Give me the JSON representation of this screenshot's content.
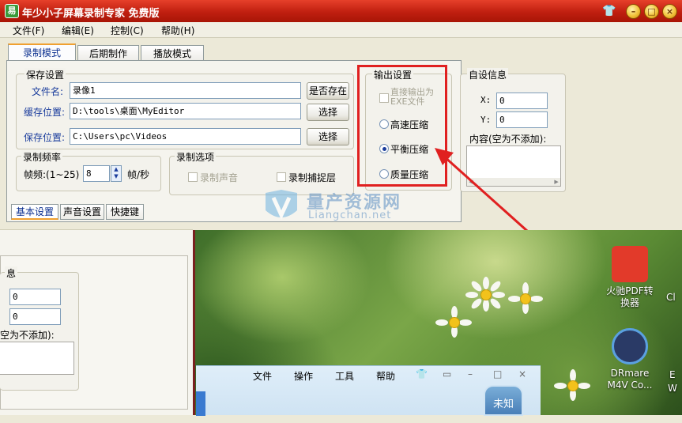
{
  "window": {
    "title": "年少小子屏幕录制专家 免费版",
    "minimize_glyph": "–",
    "maximize_glyph": "□",
    "close_glyph": "×"
  },
  "menu": [
    "文件(F)",
    "编辑(E)",
    "控制(C)",
    "帮助(H)"
  ],
  "tabs": [
    "录制模式",
    "后期制作",
    "播放模式"
  ],
  "save_settings": {
    "group_title": "保存设置",
    "filename_label": "文件名:",
    "filename_value": "录像1",
    "exists_button": "是否存在",
    "cache_label": "缓存位置:",
    "cache_value": "D:\\tools\\桌面\\MyEditor",
    "save_label": "保存位置:",
    "save_value": "C:\\Users\\pc\\Videos",
    "choose_button": "选择"
  },
  "frame_rate": {
    "group_title": "录制频率",
    "label": "帧频:(1~25)",
    "value": "8",
    "unit": "帧/秒"
  },
  "record_options": {
    "group_title": "录制选项",
    "record_audio": "录制声音",
    "record_layer": "录制捕捉层"
  },
  "output_settings": {
    "group_title": "输出设置",
    "direct_exe": "直接输出为EXE文件",
    "options": [
      "高速压缩",
      "平衡压缩",
      "质量压缩"
    ],
    "selected": "平衡压缩"
  },
  "custom_info": {
    "group_title": "自设信息",
    "x_label": "X:",
    "x_value": "0",
    "y_label": "Y:",
    "y_value": "0",
    "content_label": "内容(空为不添加):"
  },
  "subtabs": [
    "基本设置",
    "声音设置",
    "快捷键"
  ],
  "lower_left": {
    "partial_title": "息",
    "x_value": "0",
    "y_value": "0",
    "content_label": "空为不添加):"
  },
  "watermark": {
    "text": "量产资源网",
    "url": "Liangchan.net"
  },
  "desktop_icons": [
    {
      "label": "火驰PDF转\n换器",
      "icon": "pdf-converter-icon",
      "color": "#e23a2a"
    },
    {
      "label": "DRmare\nM4V Co...",
      "icon": "drmare-icon",
      "color": "#2a3a66"
    }
  ],
  "desktop_partial_labels": [
    "Cl",
    "E",
    "W"
  ],
  "mini_app_menu": [
    "文件",
    "操作",
    "工具",
    "帮助"
  ],
  "mini_app_badge": "未知",
  "colors": {
    "titlebar": "#c01f10",
    "highlight_box": "#e02020",
    "accent_tab": "#f0a030"
  }
}
